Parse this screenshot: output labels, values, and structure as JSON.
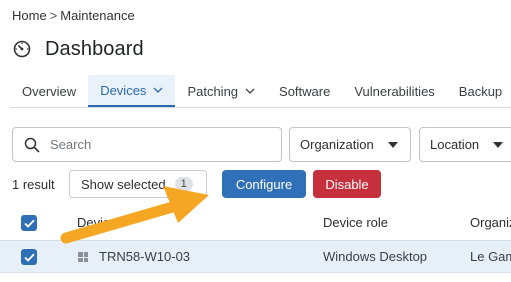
{
  "breadcrumb": {
    "home": "Home",
    "separator": ">",
    "current": "Maintenance"
  },
  "page": {
    "title": "Dashboard"
  },
  "tabs": [
    {
      "label": "Overview",
      "active": false,
      "has_chevron": false
    },
    {
      "label": "Devices",
      "active": true,
      "has_chevron": true
    },
    {
      "label": "Patching",
      "active": false,
      "has_chevron": true
    },
    {
      "label": "Software",
      "active": false,
      "has_chevron": false
    },
    {
      "label": "Vulnerabilities",
      "active": false,
      "has_chevron": false
    },
    {
      "label": "Backup",
      "active": false,
      "has_chevron": false
    }
  ],
  "filters": {
    "search_placeholder": "Search",
    "organization_label": "Organization",
    "location_label": "Location"
  },
  "toolbar": {
    "result_count": "1 result",
    "show_selected_label": "Show selected",
    "selected_count": "1",
    "configure_label": "Configure",
    "disable_label": "Disable"
  },
  "table": {
    "columns": [
      "Device",
      "Device role",
      "Organization"
    ],
    "rows": [
      {
        "selected": true,
        "device": "TRN58-W10-03",
        "device_role": "Windows Desktop",
        "organization": "Le Gam"
      }
    ]
  },
  "colors": {
    "accent": "#2b6ab3",
    "configure_bg": "#3070b8",
    "disable_bg": "#c62f3c",
    "selected_row_bg": "#e7eff9",
    "annotation_arrow": "#f5a623"
  },
  "icons": {
    "title": "dashboard-gauge-icon",
    "search": "search-icon",
    "device": "windows-icon",
    "annotation": "annotation-arrow"
  }
}
